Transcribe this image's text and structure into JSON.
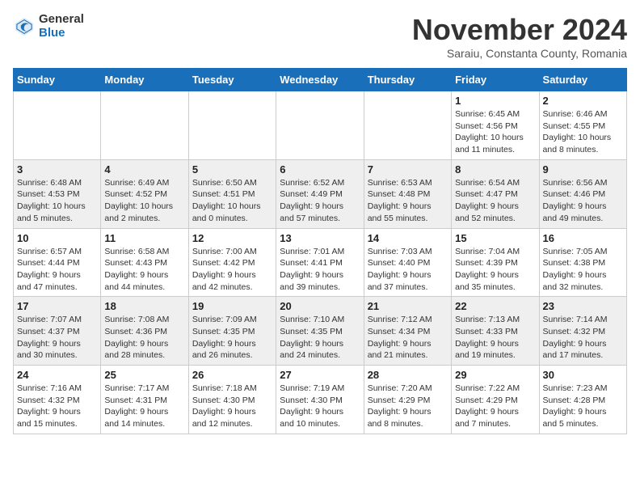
{
  "header": {
    "logo_general": "General",
    "logo_blue": "Blue",
    "month_title": "November 2024",
    "subtitle": "Saraiu, Constanta County, Romania"
  },
  "weekdays": [
    "Sunday",
    "Monday",
    "Tuesday",
    "Wednesday",
    "Thursday",
    "Friday",
    "Saturday"
  ],
  "rows": [
    [
      {
        "day": "",
        "info": ""
      },
      {
        "day": "",
        "info": ""
      },
      {
        "day": "",
        "info": ""
      },
      {
        "day": "",
        "info": ""
      },
      {
        "day": "",
        "info": ""
      },
      {
        "day": "1",
        "info": "Sunrise: 6:45 AM\nSunset: 4:56 PM\nDaylight: 10 hours\nand 11 minutes."
      },
      {
        "day": "2",
        "info": "Sunrise: 6:46 AM\nSunset: 4:55 PM\nDaylight: 10 hours\nand 8 minutes."
      }
    ],
    [
      {
        "day": "3",
        "info": "Sunrise: 6:48 AM\nSunset: 4:53 PM\nDaylight: 10 hours\nand 5 minutes."
      },
      {
        "day": "4",
        "info": "Sunrise: 6:49 AM\nSunset: 4:52 PM\nDaylight: 10 hours\nand 2 minutes."
      },
      {
        "day": "5",
        "info": "Sunrise: 6:50 AM\nSunset: 4:51 PM\nDaylight: 10 hours\nand 0 minutes."
      },
      {
        "day": "6",
        "info": "Sunrise: 6:52 AM\nSunset: 4:49 PM\nDaylight: 9 hours\nand 57 minutes."
      },
      {
        "day": "7",
        "info": "Sunrise: 6:53 AM\nSunset: 4:48 PM\nDaylight: 9 hours\nand 55 minutes."
      },
      {
        "day": "8",
        "info": "Sunrise: 6:54 AM\nSunset: 4:47 PM\nDaylight: 9 hours\nand 52 minutes."
      },
      {
        "day": "9",
        "info": "Sunrise: 6:56 AM\nSunset: 4:46 PM\nDaylight: 9 hours\nand 49 minutes."
      }
    ],
    [
      {
        "day": "10",
        "info": "Sunrise: 6:57 AM\nSunset: 4:44 PM\nDaylight: 9 hours\nand 47 minutes."
      },
      {
        "day": "11",
        "info": "Sunrise: 6:58 AM\nSunset: 4:43 PM\nDaylight: 9 hours\nand 44 minutes."
      },
      {
        "day": "12",
        "info": "Sunrise: 7:00 AM\nSunset: 4:42 PM\nDaylight: 9 hours\nand 42 minutes."
      },
      {
        "day": "13",
        "info": "Sunrise: 7:01 AM\nSunset: 4:41 PM\nDaylight: 9 hours\nand 39 minutes."
      },
      {
        "day": "14",
        "info": "Sunrise: 7:03 AM\nSunset: 4:40 PM\nDaylight: 9 hours\nand 37 minutes."
      },
      {
        "day": "15",
        "info": "Sunrise: 7:04 AM\nSunset: 4:39 PM\nDaylight: 9 hours\nand 35 minutes."
      },
      {
        "day": "16",
        "info": "Sunrise: 7:05 AM\nSunset: 4:38 PM\nDaylight: 9 hours\nand 32 minutes."
      }
    ],
    [
      {
        "day": "17",
        "info": "Sunrise: 7:07 AM\nSunset: 4:37 PM\nDaylight: 9 hours\nand 30 minutes."
      },
      {
        "day": "18",
        "info": "Sunrise: 7:08 AM\nSunset: 4:36 PM\nDaylight: 9 hours\nand 28 minutes."
      },
      {
        "day": "19",
        "info": "Sunrise: 7:09 AM\nSunset: 4:35 PM\nDaylight: 9 hours\nand 26 minutes."
      },
      {
        "day": "20",
        "info": "Sunrise: 7:10 AM\nSunset: 4:35 PM\nDaylight: 9 hours\nand 24 minutes."
      },
      {
        "day": "21",
        "info": "Sunrise: 7:12 AM\nSunset: 4:34 PM\nDaylight: 9 hours\nand 21 minutes."
      },
      {
        "day": "22",
        "info": "Sunrise: 7:13 AM\nSunset: 4:33 PM\nDaylight: 9 hours\nand 19 minutes."
      },
      {
        "day": "23",
        "info": "Sunrise: 7:14 AM\nSunset: 4:32 PM\nDaylight: 9 hours\nand 17 minutes."
      }
    ],
    [
      {
        "day": "24",
        "info": "Sunrise: 7:16 AM\nSunset: 4:32 PM\nDaylight: 9 hours\nand 15 minutes."
      },
      {
        "day": "25",
        "info": "Sunrise: 7:17 AM\nSunset: 4:31 PM\nDaylight: 9 hours\nand 14 minutes."
      },
      {
        "day": "26",
        "info": "Sunrise: 7:18 AM\nSunset: 4:30 PM\nDaylight: 9 hours\nand 12 minutes."
      },
      {
        "day": "27",
        "info": "Sunrise: 7:19 AM\nSunset: 4:30 PM\nDaylight: 9 hours\nand 10 minutes."
      },
      {
        "day": "28",
        "info": "Sunrise: 7:20 AM\nSunset: 4:29 PM\nDaylight: 9 hours\nand 8 minutes."
      },
      {
        "day": "29",
        "info": "Sunrise: 7:22 AM\nSunset: 4:29 PM\nDaylight: 9 hours\nand 7 minutes."
      },
      {
        "day": "30",
        "info": "Sunrise: 7:23 AM\nSunset: 4:28 PM\nDaylight: 9 hours\nand 5 minutes."
      }
    ]
  ]
}
